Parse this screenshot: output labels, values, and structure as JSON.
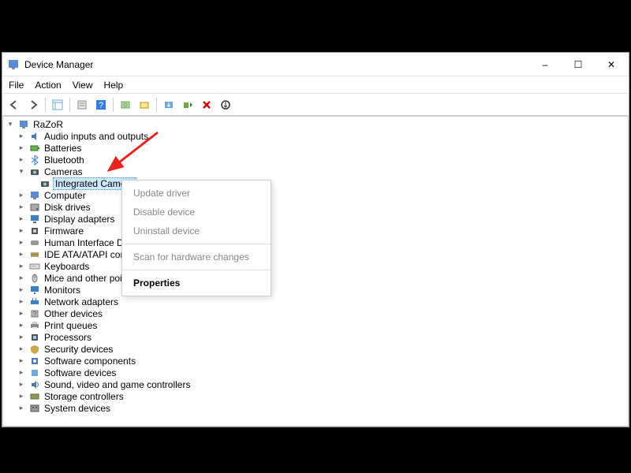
{
  "window": {
    "title": "Device Manager",
    "minimize": "–",
    "maximize": "☐",
    "close": "✕"
  },
  "menu": {
    "file": "File",
    "action": "Action",
    "view": "View",
    "help": "Help"
  },
  "toolbar": {
    "back": "back",
    "forward": "forward",
    "show_hide": "show-hide",
    "props": "properties",
    "help": "help",
    "refresh": "refresh",
    "scan": "scan",
    "update": "update",
    "enable": "enable",
    "disable": "disable",
    "uninstall": "uninstall"
  },
  "tree": {
    "root": "RaZoR",
    "nodes": [
      {
        "label": "Audio inputs and outputs",
        "icon": "audio"
      },
      {
        "label": "Batteries",
        "icon": "battery"
      },
      {
        "label": "Bluetooth",
        "icon": "bluetooth"
      },
      {
        "label": "Cameras",
        "icon": "camera",
        "expanded": true,
        "children": [
          {
            "label": "Integrated Camera",
            "icon": "camera",
            "selected": true
          }
        ]
      },
      {
        "label": "Computer",
        "icon": "computer"
      },
      {
        "label": "Disk drives",
        "icon": "disk"
      },
      {
        "label": "Display adapters",
        "icon": "display"
      },
      {
        "label": "Firmware",
        "icon": "firmware"
      },
      {
        "label": "Human Interface Devices",
        "icon": "hid"
      },
      {
        "label": "IDE ATA/ATAPI controllers",
        "icon": "ide"
      },
      {
        "label": "Keyboards",
        "icon": "keyboard"
      },
      {
        "label": "Mice and other pointing devices",
        "icon": "mouse"
      },
      {
        "label": "Monitors",
        "icon": "monitor"
      },
      {
        "label": "Network adapters",
        "icon": "network"
      },
      {
        "label": "Other devices",
        "icon": "other"
      },
      {
        "label": "Print queues",
        "icon": "printer"
      },
      {
        "label": "Processors",
        "icon": "cpu"
      },
      {
        "label": "Security devices",
        "icon": "security"
      },
      {
        "label": "Software components",
        "icon": "soft-comp"
      },
      {
        "label": "Software devices",
        "icon": "soft-dev"
      },
      {
        "label": "Sound, video and game controllers",
        "icon": "sound"
      },
      {
        "label": "Storage controllers",
        "icon": "storage"
      },
      {
        "label": "System devices",
        "icon": "system"
      }
    ]
  },
  "context_menu": {
    "update_driver": "Update driver",
    "disable_device": "Disable device",
    "uninstall_device": "Uninstall device",
    "scan_changes": "Scan for hardware changes",
    "properties": "Properties"
  },
  "annotation": {
    "arrow_points_to": "Integrated Camera"
  }
}
